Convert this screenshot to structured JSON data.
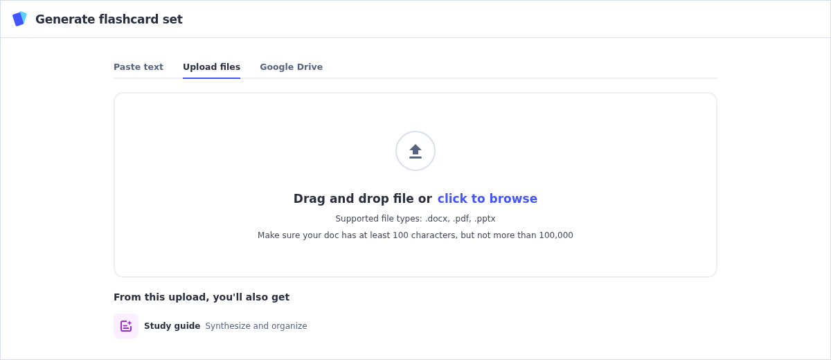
{
  "header": {
    "title": "Generate flashcard set"
  },
  "tabs": [
    {
      "label": "Paste text",
      "selected": false
    },
    {
      "label": "Upload files",
      "selected": true
    },
    {
      "label": "Google Drive",
      "selected": false
    }
  ],
  "dropzone": {
    "headline": "Drag and drop file or",
    "link": "click to browse",
    "supported": "Supported file types: .docx, .pdf, .pptx",
    "note": "Make sure your doc has at least 100 characters, but not more than 100,000"
  },
  "extras": {
    "heading": "From this upload, you'll also get",
    "items": [
      {
        "name": "Study guide",
        "description": "Synthesize and organize"
      }
    ]
  }
}
